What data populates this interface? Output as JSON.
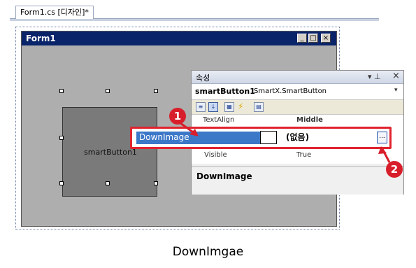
{
  "document_tab": {
    "label": "Form1.cs [디자인]*"
  },
  "form": {
    "title": "Form1",
    "minimize_glyph": "_",
    "maximize_glyph": "□",
    "close_glyph": "×"
  },
  "control": {
    "label": "smartButton1"
  },
  "properties": {
    "title": "속성",
    "pin_glyph": "▾ ⊥",
    "close_glyph": "×",
    "object_name": "smartButton1",
    "object_type": "SmartX.SmartButton",
    "object_dropdown_glyph": "▾",
    "grid_row_1": {
      "name": "TextAlign",
      "value": "Middle"
    },
    "grid_row_2": {
      "name": "Visible",
      "value": "True"
    },
    "description_title": "DownImage"
  },
  "highlighted_row": {
    "name": "DownImage",
    "value": "(없음)",
    "ellipsis_label": "..."
  },
  "callouts": {
    "one": "1",
    "two": "2"
  },
  "caption": "DownImgae",
  "colors": {
    "highlight": "#e0242f",
    "callout": "#d81e2b",
    "selection": "#3c78c8",
    "titlebar": "#0a246a"
  }
}
